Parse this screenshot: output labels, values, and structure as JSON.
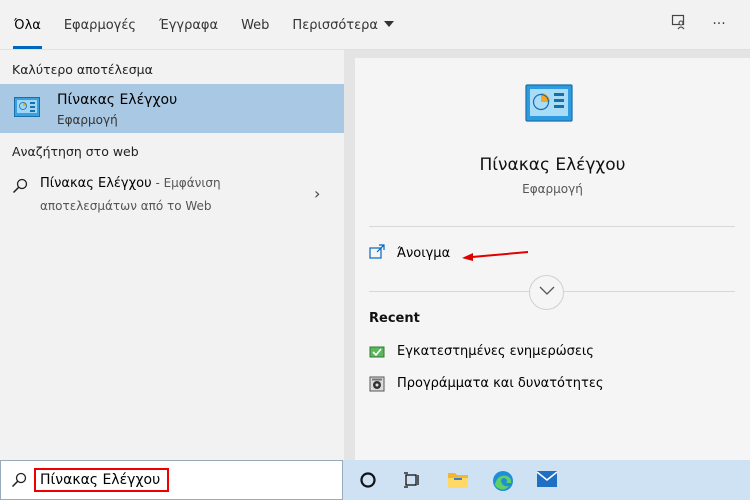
{
  "tabs": [
    {
      "label": "Όλα",
      "active": true
    },
    {
      "label": "Εφαρμογές"
    },
    {
      "label": "Έγγραφα"
    },
    {
      "label": "Web"
    },
    {
      "label": "Περισσότερα"
    }
  ],
  "topbar_icons": [
    "feedback-icon",
    "more-options-icon"
  ],
  "more_dots": "···",
  "left": {
    "best_match_title": "Καλύτερο αποτέλεσμα",
    "best_match": {
      "name": "Πίνακας Ελέγχου",
      "type": "Εφαρμογή",
      "icon": "control-panel-icon"
    },
    "web_title": "Αναζήτηση στο web",
    "web_result": {
      "query": "Πίνακας Ελέγχου",
      "suffix": " - Εμφάνιση",
      "line2": "αποτελεσμάτων από το Web",
      "chevron": "›"
    }
  },
  "detail": {
    "title": "Πίνακας Ελέγχου",
    "subtitle": "Εφαρμογή",
    "open_label": "Άνοιγμα",
    "recent_title": "Recent",
    "recent_items": [
      {
        "label": "Εγκατεστημένες ενημερώσεις",
        "icon": "installed-updates-icon"
      },
      {
        "label": "Προγράμματα και δυνατότητες",
        "icon": "programs-features-icon"
      }
    ]
  },
  "taskbar": {
    "search_value": "Πίνακας Ελέγχου",
    "icons": [
      "cortana-icon",
      "task-view-icon",
      "file-explorer-icon",
      "edge-icon",
      "mail-icon"
    ]
  },
  "colors": {
    "accent": "#0067c0",
    "selection": "#a9c8e3",
    "highlight": "#e00000"
  }
}
